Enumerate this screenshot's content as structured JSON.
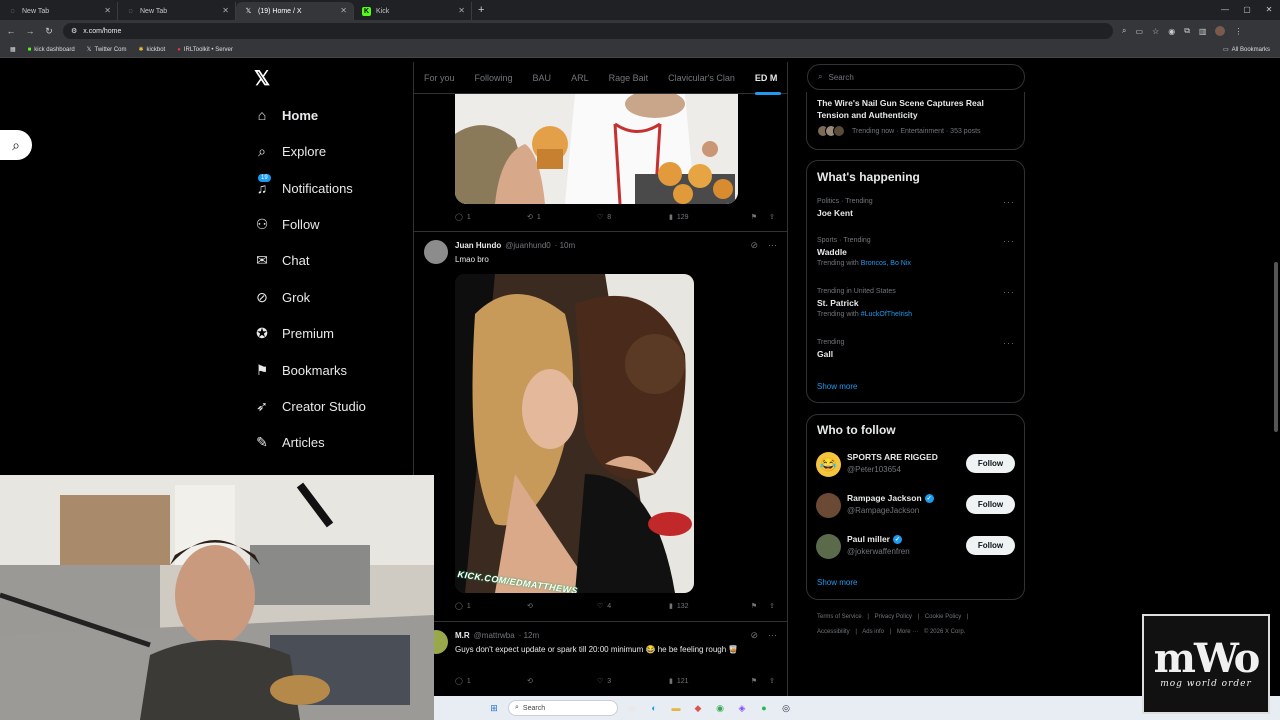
{
  "browser": {
    "tabs": [
      {
        "label": "New Tab",
        "active": false
      },
      {
        "label": "New Tab",
        "active": false
      },
      {
        "label": "(19) Home / X",
        "active": true
      },
      {
        "label": "Kick",
        "active": false
      }
    ],
    "url": "x.com/home",
    "bookmarks": [
      "kick dashboard",
      "Twitter Com",
      "kickbot",
      "IRLToolkit • Server"
    ],
    "all_bookmarks": "All Bookmarks"
  },
  "nav": {
    "items": [
      {
        "label": "Home",
        "icon": "home-icon"
      },
      {
        "label": "Explore",
        "icon": "search-icon"
      },
      {
        "label": "Notifications",
        "icon": "bell-icon",
        "badge": "19"
      },
      {
        "label": "Follow",
        "icon": "person-plus-icon"
      },
      {
        "label": "Chat",
        "icon": "mail-icon"
      },
      {
        "label": "Grok",
        "icon": "grok-icon"
      },
      {
        "label": "Premium",
        "icon": "premium-icon"
      },
      {
        "label": "Bookmarks",
        "icon": "bookmark-icon"
      },
      {
        "label": "Creator Studio",
        "icon": "rocket-icon"
      },
      {
        "label": "Articles",
        "icon": "articles-icon"
      }
    ]
  },
  "feed": {
    "tabs": [
      "For you",
      "Following",
      "BAU",
      "ARL",
      "Rage Bait",
      "Clavicular's Clan",
      "ED M"
    ],
    "post1_stats": {
      "replies": "1",
      "reposts": "1",
      "likes": "8",
      "views": "129"
    },
    "post2": {
      "name": "Juan Hundo",
      "handle": "@juanhund0",
      "time": "· 10m",
      "text": "Lmao bro",
      "watermark": "KICK.COM/EDMATTHEWS",
      "stats": {
        "replies": "1",
        "reposts": "",
        "likes": "4",
        "views": "132"
      }
    },
    "post3": {
      "name": "M.R",
      "handle": "@mattrwba",
      "time": "· 12m",
      "text": "Guys don't expect update or spark till 20:00 minimum 😂 he be feeling rough 🥃",
      "stats": {
        "replies": "1",
        "reposts": "",
        "likes": "3",
        "views": "121"
      }
    }
  },
  "right": {
    "search_placeholder": "Search",
    "top_trend": {
      "title": "The Wire's Nail Gun Scene Captures Real Tension and Authenticity",
      "meta": "Trending now · Entertainment · 353 posts"
    },
    "whats_happening": "What's happening",
    "trends": [
      {
        "meta": "Politics · Trending",
        "name": "Joe Kent",
        "with_label": "",
        "with_links": ""
      },
      {
        "meta": "Sports · Trending",
        "name": "Waddle",
        "with_label": "Trending with",
        "with_links": "Broncos, Bo Nix"
      },
      {
        "meta": "Trending in United States",
        "name": "St. Patrick",
        "with_label": "Trending with",
        "with_links": "#LuckOfTheIrish"
      },
      {
        "meta": "Trending",
        "name": "Gall",
        "with_label": "",
        "with_links": ""
      }
    ],
    "show_more": "Show more",
    "who_to_follow": "Who to follow",
    "follow_suggestions": [
      {
        "name": "SPORTS ARE RIGGED",
        "handle": "@Peter103654",
        "verified": false,
        "button": "Follow"
      },
      {
        "name": "Rampage Jackson",
        "handle": "@RampageJackson",
        "verified": true,
        "button": "Follow"
      },
      {
        "name": "Paul miller",
        "handle": "@jokerwaffenfren",
        "verified": true,
        "button": "Follow"
      }
    ],
    "footer": {
      "line1": [
        "Terms of Service",
        "|",
        "Privacy Policy",
        "|",
        "Cookie Policy",
        "|"
      ],
      "line2": [
        "Accessibility",
        "|",
        "Ads info",
        "|",
        "More ···",
        "© 2026 X Corp."
      ]
    }
  },
  "taskbar": {
    "search": "Search"
  },
  "overlay": {
    "logo_big": "mWo",
    "logo_small": "mog world order"
  }
}
